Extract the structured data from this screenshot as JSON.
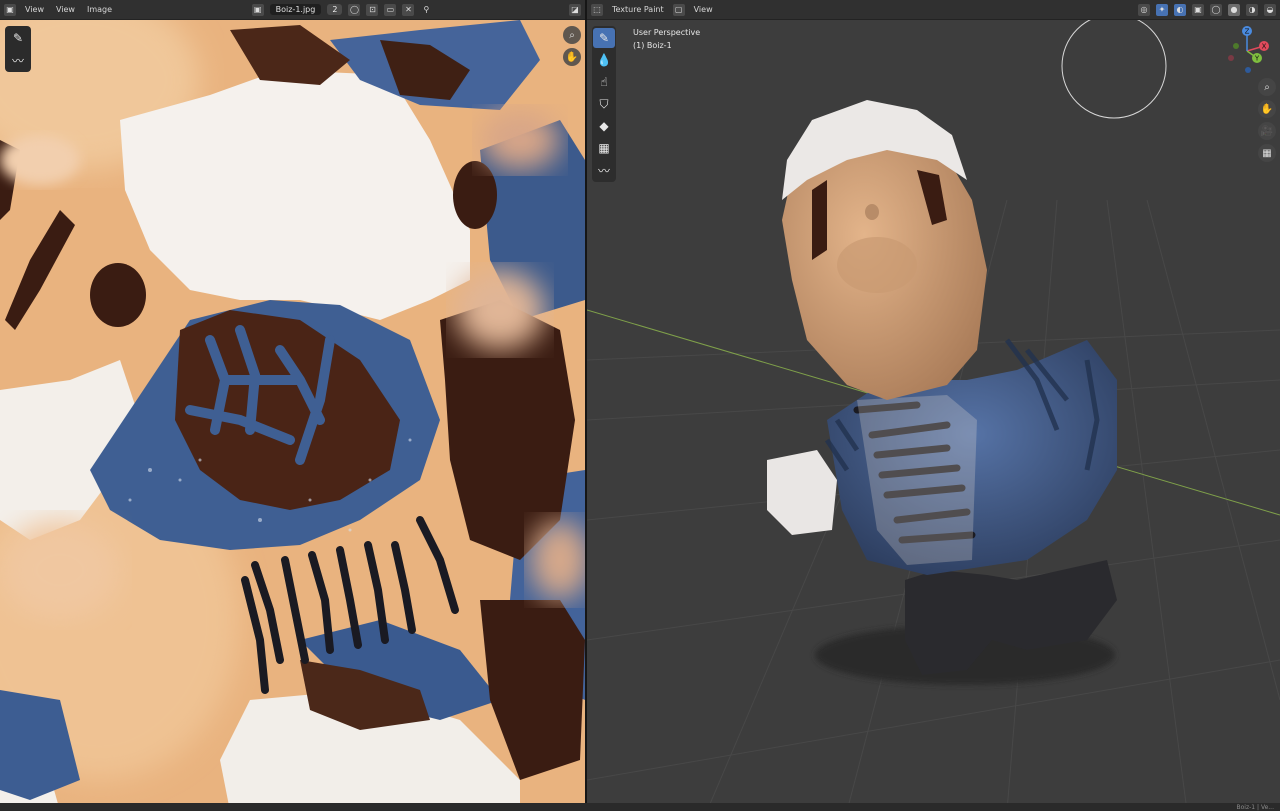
{
  "image_editor": {
    "menus": [
      "View",
      "View",
      "Image"
    ],
    "image_name": "Boiz-1.jpg",
    "user_count": "2"
  },
  "viewport": {
    "mode": "Texture Paint",
    "menu_view": "View",
    "perspective": "User Perspective",
    "object_name": "(1) Boiz-1",
    "gizmo_axes": [
      "X",
      "Y",
      "Z"
    ]
  },
  "status_bar": {
    "right_text": "Boiz-1 | Ve..."
  },
  "colors": {
    "accent": "#4772b3",
    "clay": "#e9b37f",
    "glaze_blue": "#3f5f93",
    "dark_brown": "#3a1c12",
    "viewport_bg": "#3d3d3d",
    "axis_x": "#e04a5c",
    "axis_y": "#7fbf3f",
    "axis_z": "#4a8be0"
  },
  "icons": [
    "eyedropper-icon",
    "brush-icon",
    "draw-icon",
    "soften-icon",
    "smear-icon",
    "clone-icon",
    "fill-icon",
    "mask-icon",
    "annotate-icon",
    "zoom-icon",
    "hand-icon",
    "camera-icon",
    "grid-icon"
  ]
}
